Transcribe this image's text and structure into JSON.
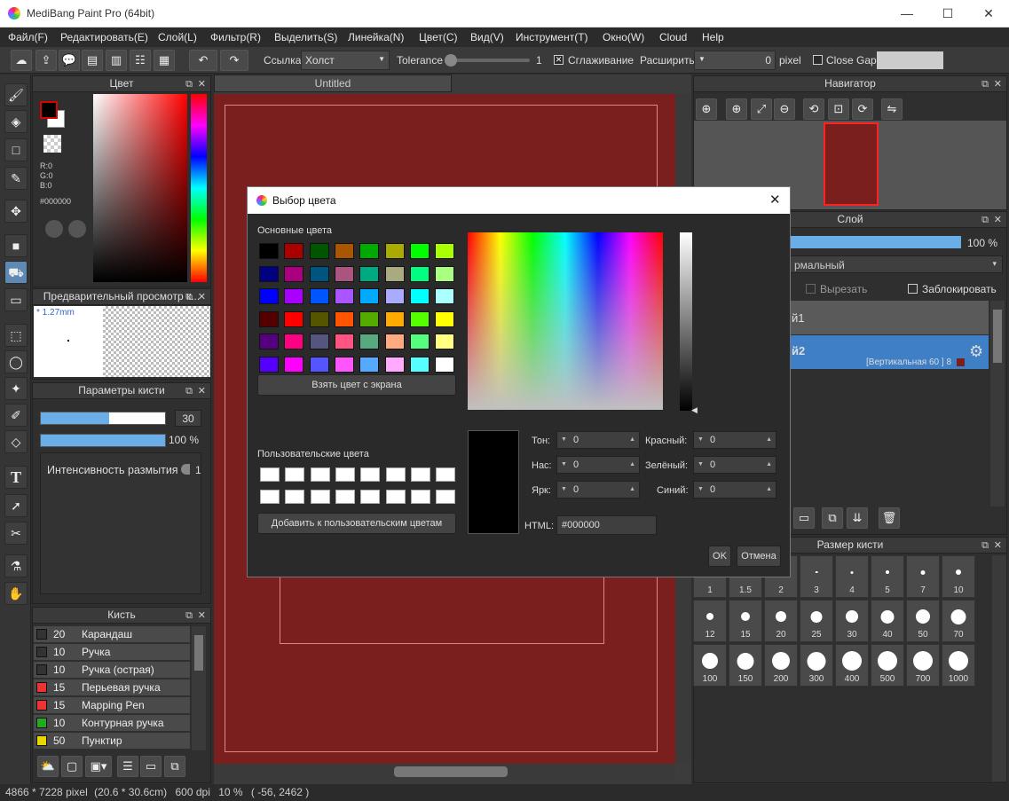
{
  "window": {
    "title": "MediBang Paint Pro (64bit)",
    "minimize": "—",
    "maximize": "☐",
    "close": "✕"
  },
  "menu": [
    "Файл(F)",
    "Редактировать(E)",
    "Слой(L)",
    "Фильтр(R)",
    "Выделить(S)",
    "Линейка(N)",
    "Цвет(C)",
    "Вид(V)",
    "Инструмент(T)",
    "Окно(W)",
    "Cloud",
    "Help"
  ],
  "toolbar": {
    "ref_label": "Ссылка",
    "ref_value": "Холст",
    "tolerance_label": "Tolerance",
    "tolerance_value": "1",
    "smoothing_label": "Сглаживание",
    "expand_label": "Расширить",
    "expand_value": "0",
    "expand_unit": "pixel",
    "close_gaps_label": "Close Gaps",
    "smoothing_checked": true,
    "close_gaps_checked": false
  },
  "color_panel": {
    "title": "Цвет",
    "r": "R:0",
    "g": "G:0",
    "b": "B:0",
    "hex": "#000000",
    "primary_color": "#000000",
    "secondary_color": "#ffffff"
  },
  "preview_panel": {
    "title": "Предварительный просмотр к...",
    "size": "* 1.27mm"
  },
  "brush_params": {
    "title": "Параметры кисти",
    "size_value": "30",
    "opacity_value": "100 %",
    "blur_label": "Интенсивность размытия",
    "blur_value": "1",
    "size_fraction": 0.55,
    "opacity_fraction": 1.0
  },
  "brush_panel": {
    "title": "Кисть",
    "items": [
      {
        "size": "20",
        "name": "Карандаш",
        "color": "#333333"
      },
      {
        "size": "10",
        "name": "Ручка",
        "color": "#333333"
      },
      {
        "size": "10",
        "name": "Ручка (острая)",
        "color": "#333333"
      },
      {
        "size": "15",
        "name": "Перьевая ручка",
        "color": "#ee3333"
      },
      {
        "size": "15",
        "name": "Mapping Pen",
        "color": "#ee3333"
      },
      {
        "size": "10",
        "name": "Контурная ручка",
        "color": "#22aa22"
      },
      {
        "size": "50",
        "name": "Пунктир",
        "color": "#e8d800"
      }
    ]
  },
  "canvas": {
    "tab": "Untitled",
    "color": "#7a1e1e"
  },
  "navigator": {
    "title": "Навигатор"
  },
  "layer_panel": {
    "title": "Слой",
    "opacity": "100 %",
    "blend": "рмальный",
    "clip_label": "Вырезать",
    "lock_label": "Заблокировать",
    "layer1": "й1",
    "layer2": "й2",
    "layer2_info": "[Вертикальная 60 ] 8",
    "layer2_color": "#7a1e1e"
  },
  "brush_size_panel": {
    "title": "Размер кисти",
    "sizes": [
      "1",
      "1.5",
      "2",
      "3",
      "4",
      "5",
      "7",
      "10",
      "12",
      "15",
      "20",
      "25",
      "30",
      "40",
      "50",
      "70",
      "100",
      "150",
      "200",
      "300",
      "400",
      "500",
      "700",
      "1000"
    ]
  },
  "dialog": {
    "title": "Выбор цвета",
    "close": "✕",
    "basic_label": "Основные цвета",
    "basic_colors": [
      "#000000",
      "#aa0000",
      "#005500",
      "#aa5500",
      "#00aa00",
      "#aaaa00",
      "#00ff00",
      "#aaff00",
      "#000080",
      "#aa0080",
      "#005580",
      "#aa5580",
      "#00aa80",
      "#aaaa80",
      "#00ff80",
      "#aaff80",
      "#0000ff",
      "#aa00ff",
      "#0055ff",
      "#aa55ff",
      "#00aaff",
      "#aaaaff",
      "#00ffff",
      "#aaffff",
      "#550000",
      "#ff0000",
      "#555500",
      "#ff5500",
      "#55aa00",
      "#ffaa00",
      "#55ff00",
      "#ffff00",
      "#550080",
      "#ff0080",
      "#555580",
      "#ff5580",
      "#55aa80",
      "#ffaa80",
      "#55ff80",
      "#ffff80",
      "#5500ff",
      "#ff00ff",
      "#5555ff",
      "#ff55ff",
      "#55aaff",
      "#ffaaff",
      "#55ffff",
      "#ffffff"
    ],
    "pick_screen": "Взять цвет с экрана",
    "custom_label": "Пользовательские цвета",
    "add_custom": "Добавить к пользовательским цветам",
    "hue_label": "Тон:",
    "sat_label": "Нас:",
    "val_label": "Ярк:",
    "red_label": "Красный:",
    "green_label": "Зелёный:",
    "blue_label": "Синий:",
    "hue": "0",
    "sat": "0",
    "val": "0",
    "red": "0",
    "green": "0",
    "blue": "0",
    "html_label": "HTML:",
    "html_value": "#000000",
    "ok": "OK",
    "cancel": "Отмена",
    "current_color": "#000000"
  },
  "status": {
    "dims": "4866 * 7228 pixel",
    "cm": "(20.6 * 30.6cm)",
    "dpi": "600 dpi",
    "zoom": "10 %",
    "coords": "( -56, 2462 )"
  }
}
